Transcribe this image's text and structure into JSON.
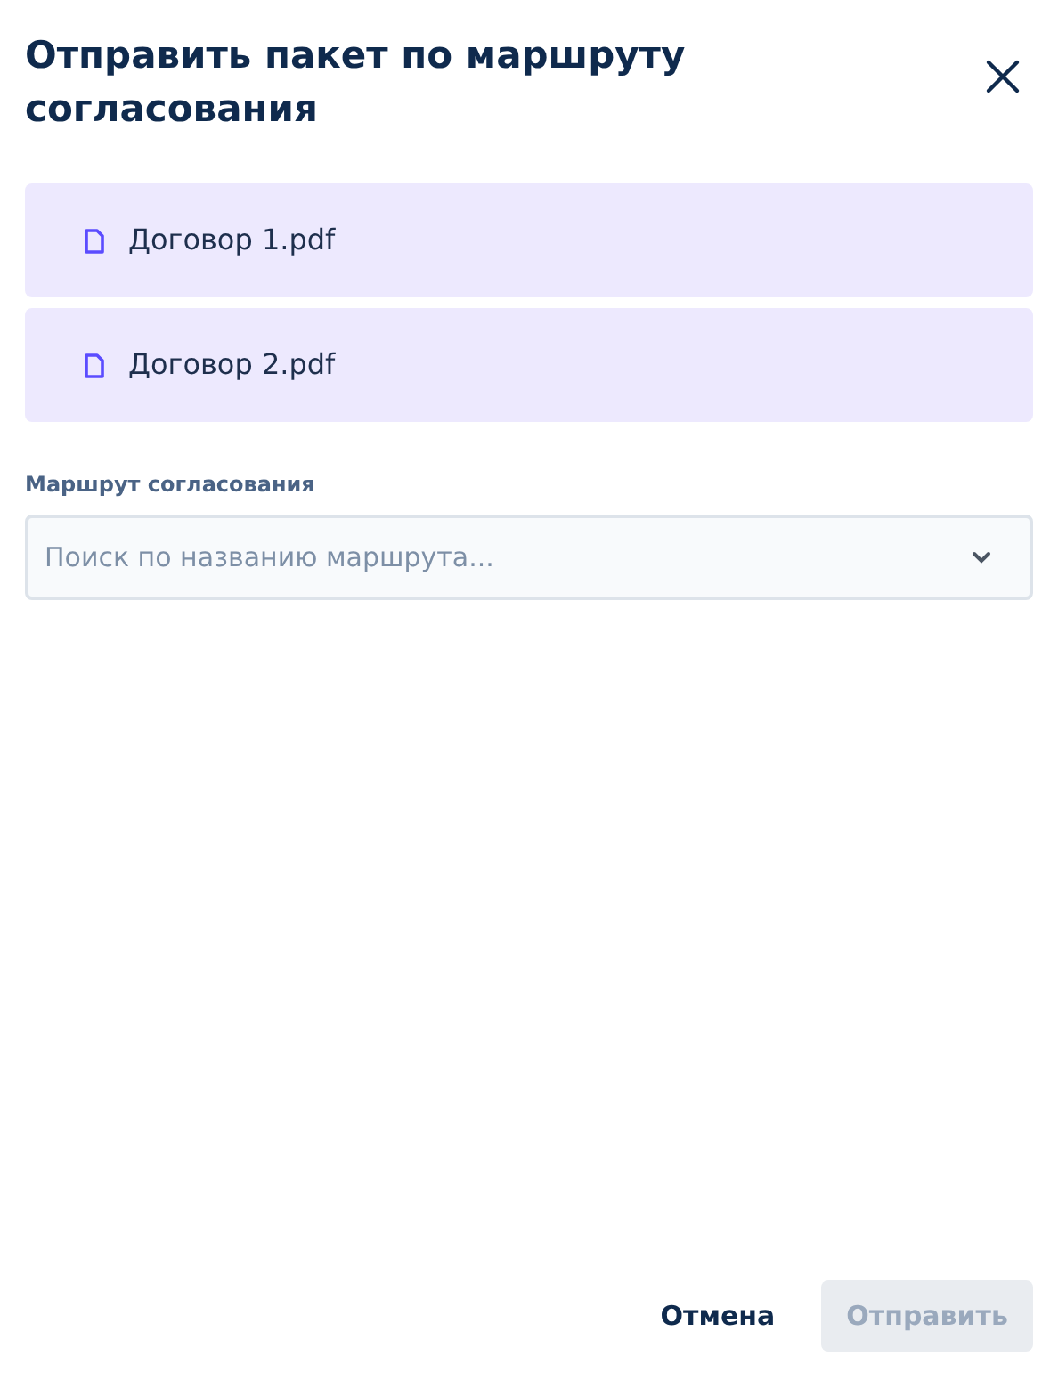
{
  "dialog": {
    "title": "Отправить пакет по маршруту согласования"
  },
  "files": [
    {
      "name": "Договор 1.pdf"
    },
    {
      "name": "Договор 2.pdf"
    }
  ],
  "route_field": {
    "label": "Маршрут согласования",
    "placeholder": "Поиск по названию маршрута..."
  },
  "buttons": [
    {
      "label": "Отмена",
      "kind": "secondary",
      "disabled": false
    },
    {
      "label": "Отправить",
      "kind": "primary",
      "disabled": true
    }
  ]
}
